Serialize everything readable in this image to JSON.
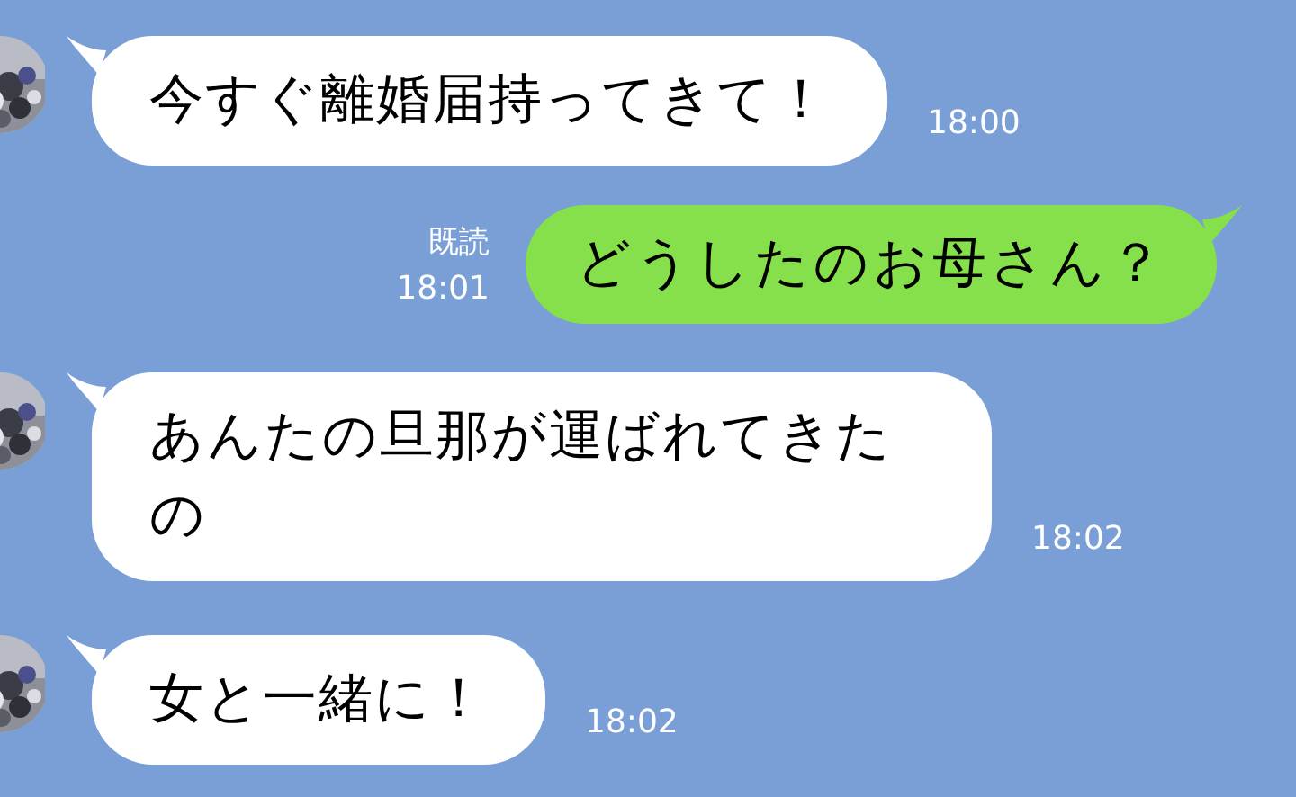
{
  "messages": [
    {
      "kind": "received",
      "text": "今すぐ離婚届持ってきて！",
      "time": "18:00"
    },
    {
      "kind": "sent",
      "text": "どうしたのお母さん？",
      "time": "18:01",
      "read_label": "既読"
    },
    {
      "kind": "received",
      "text": "あんたの旦那が運ばれてきたの",
      "time": "18:02"
    },
    {
      "kind": "received",
      "text": "女と一緒に！",
      "time": "18:02"
    }
  ]
}
